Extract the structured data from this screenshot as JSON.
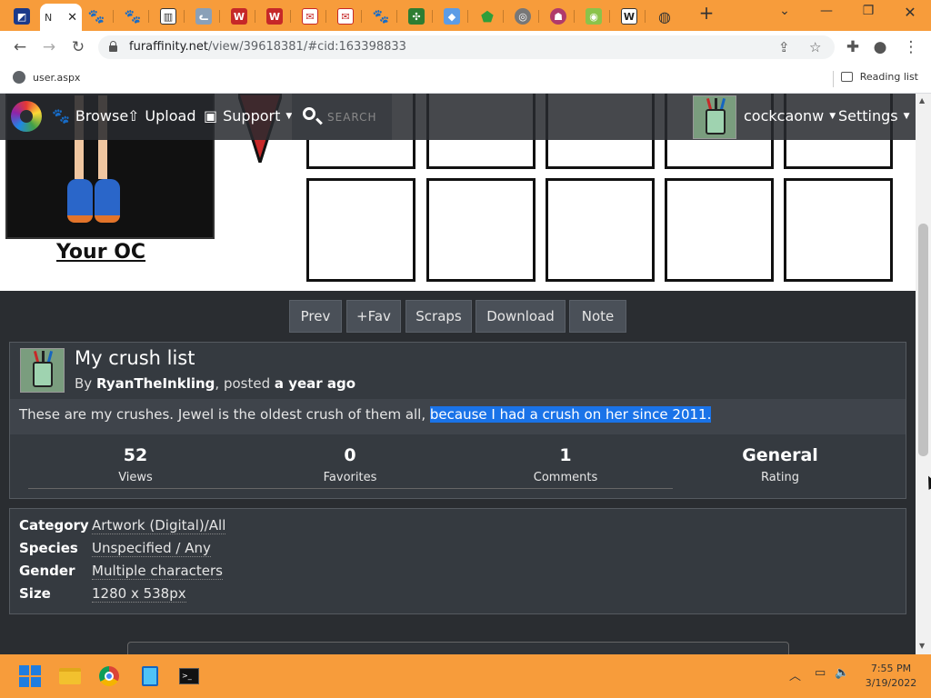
{
  "browser": {
    "active_tab_title": "N",
    "url_host": "furaffinity.net",
    "url_path": "/view/39618381/#cid:163398833",
    "bookmark_item": "user.aspx",
    "reading_list": "Reading list",
    "tab_favicons": [
      "paw-icon",
      "paw-icon",
      "paw-icon",
      "library-icon",
      "cat-icon",
      "w-icon",
      "w-icon",
      "mail-icon",
      "mail-icon",
      "paw-icon",
      "grid-icon",
      "puzzle-icon",
      "gem-icon",
      "globe-icon",
      "creature-icon",
      "owl-icon",
      "w-icon",
      "ring-icon"
    ]
  },
  "fa_nav": {
    "browse": "Browse",
    "upload": "Upload",
    "support": "Support",
    "search_placeholder": "SEARCH",
    "username": "cockcaonw",
    "settings": "Settings"
  },
  "artwork": {
    "oc_label": "Your OC"
  },
  "actions": {
    "prev": "Prev",
    "fav": "+Fav",
    "scraps": "Scraps",
    "download": "Download",
    "note": "Note"
  },
  "submission": {
    "title": "My crush list",
    "by_prefix": "By ",
    "author": "RyanTheInkling",
    "posted_prefix": ", posted ",
    "posted": "a year ago",
    "description_plain": "These are my crushes. Jewel is the oldest crush of them all, ",
    "description_selected": "because I had a crush on her since 2011.",
    "stats": [
      {
        "value": "52",
        "label": "Views"
      },
      {
        "value": "0",
        "label": "Favorites"
      },
      {
        "value": "1",
        "label": "Comments"
      },
      {
        "value": "General",
        "label": "Rating"
      }
    ]
  },
  "info": [
    {
      "key": "Category",
      "value": "Artwork (Digital)/All"
    },
    {
      "key": "Species",
      "value": "Unspecified / Any"
    },
    {
      "key": "Gender",
      "value": "Multiple characters"
    },
    {
      "key": "Size",
      "value": "1280 x 538px"
    }
  ],
  "taskbar": {
    "time": "7:55 PM",
    "date": "3/19/2022"
  },
  "colors": {
    "accent_orange": "#f79c3b",
    "page_bg": "#2a2d31",
    "selection": "#1a73e8"
  }
}
